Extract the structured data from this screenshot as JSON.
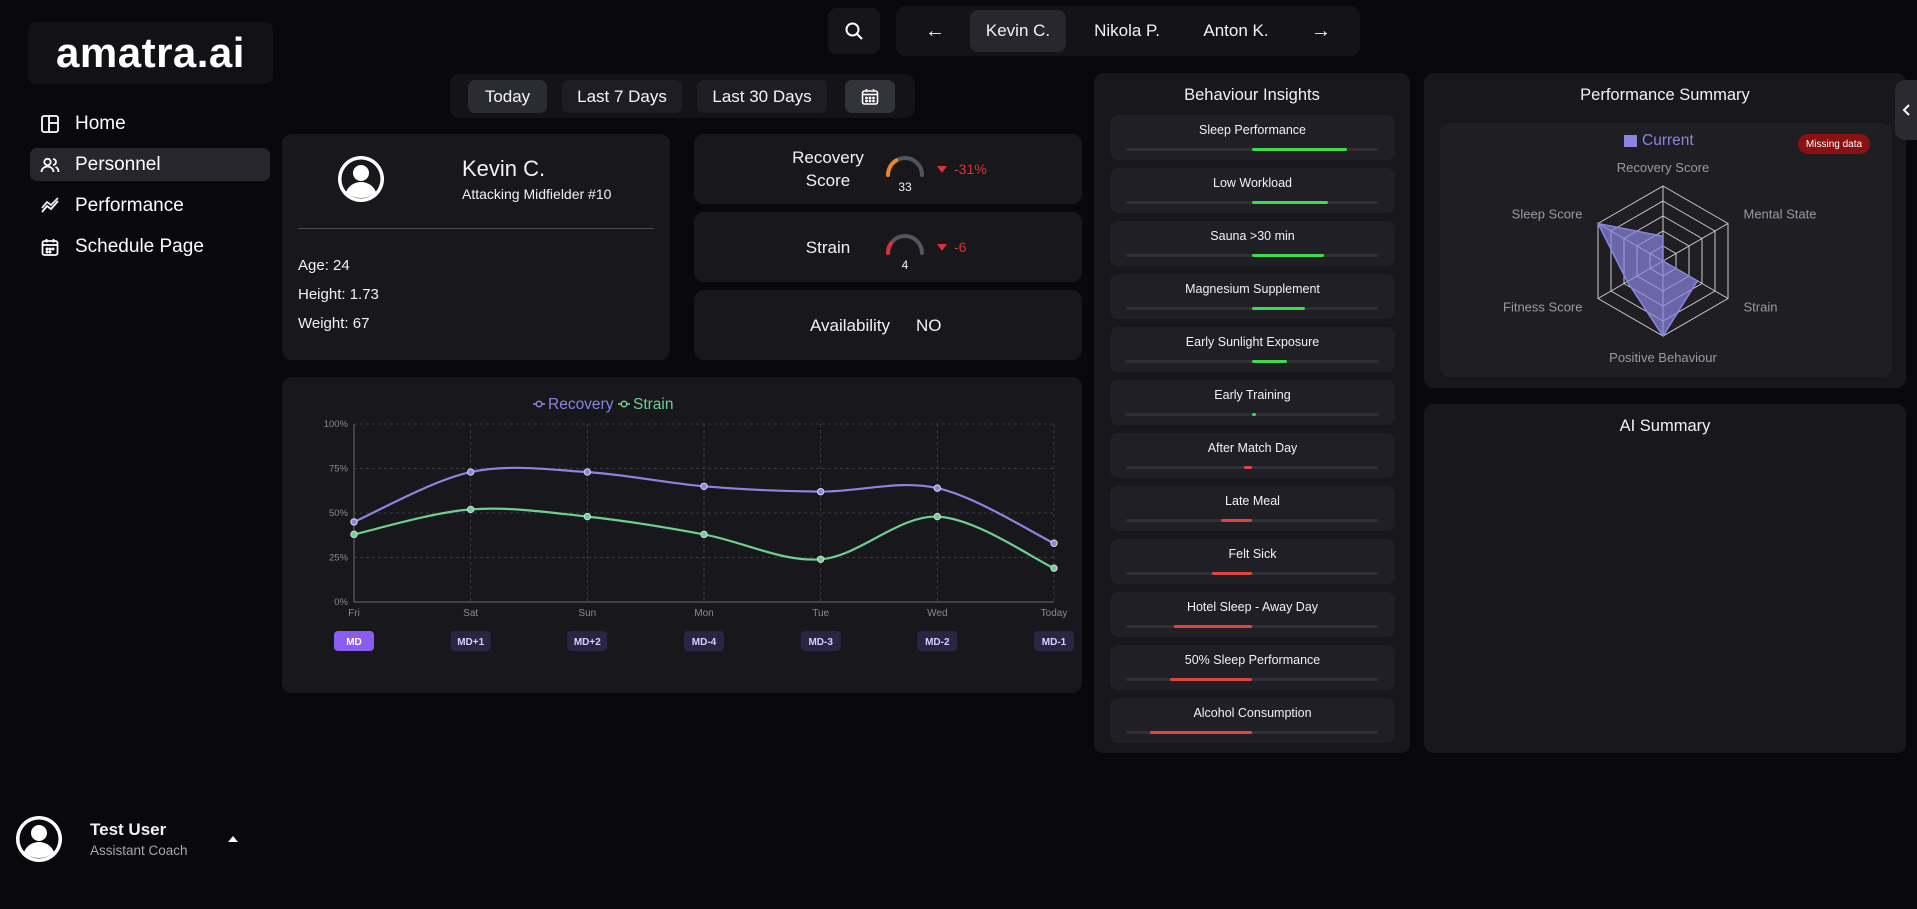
{
  "brand": {
    "logo": "amatra.ai"
  },
  "nav": {
    "items": [
      {
        "label": "Home",
        "icon": "layout-icon",
        "active": false
      },
      {
        "label": "Personnel",
        "icon": "users-icon",
        "active": true
      },
      {
        "label": "Performance",
        "icon": "trend-icon",
        "active": false
      },
      {
        "label": "Schedule Page",
        "icon": "calendar-icon",
        "active": false
      }
    ]
  },
  "user": {
    "name": "Test User",
    "role": "Assistant Coach"
  },
  "players": {
    "prev": "←",
    "next": "→",
    "tabs": [
      "Kevin C.",
      "Nikola P.",
      "Anton K."
    ],
    "active": "Kevin C."
  },
  "range": {
    "options": [
      "Today",
      "Last 7 Days",
      "Last 30 Days"
    ],
    "active": "Today"
  },
  "profile": {
    "name": "Kevin C.",
    "position": "Attacking Midfielder #10",
    "age": "Age: 24",
    "height": "Height: 1.73",
    "weight": "Weight: 67"
  },
  "metrics": {
    "recovery": {
      "label_line1": "Recovery",
      "label_line2": "Score",
      "value": "33",
      "delta": "-31%",
      "gauge_color": "#e8862b",
      "gauge_fraction": 0.33
    },
    "strain": {
      "label": "Strain",
      "value": "4",
      "delta": "-6",
      "gauge_color": "#d8333a",
      "gauge_fraction": 0.19
    },
    "availability": {
      "label": "Availability",
      "value": "NO"
    }
  },
  "chart_data": {
    "type": "line",
    "legend": [
      "Recovery",
      "Strain"
    ],
    "x": [
      "Fri",
      "Sat",
      "Sun",
      "Mon",
      "Tue",
      "Wed",
      "Today"
    ],
    "ytick_labels": [
      "0%",
      "25%",
      "50%",
      "75%",
      "100%"
    ],
    "ylim": [
      0,
      100
    ],
    "series": [
      {
        "name": "Recovery",
        "color": "#8b85e0",
        "values": [
          45,
          73,
          73,
          65,
          62,
          64,
          33
        ]
      },
      {
        "name": "Strain",
        "color": "#6fcf8e",
        "values": [
          38,
          52,
          48,
          38,
          24,
          48,
          19
        ]
      }
    ],
    "match_days": [
      "MD",
      "MD+1",
      "MD+2",
      "MD-4",
      "MD-3",
      "MD-2",
      "MD-1"
    ],
    "active_match_day": "MD",
    "grid": true
  },
  "behaviour": {
    "title": "Behaviour Insights",
    "items": [
      {
        "label": "Sleep Performance",
        "side": "positive",
        "fraction": 0.75
      },
      {
        "label": "Low Workload",
        "side": "positive",
        "fraction": 0.6
      },
      {
        "label": "Sauna >30 min",
        "side": "positive",
        "fraction": 0.57
      },
      {
        "label": "Magnesium Supplement",
        "side": "positive",
        "fraction": 0.42
      },
      {
        "label": "Early Sunlight Exposure",
        "side": "positive",
        "fraction": 0.28
      },
      {
        "label": "Early Training",
        "side": "positive",
        "fraction": 0.03
      },
      {
        "label": "After Match Day",
        "side": "negative",
        "fraction": 0.06
      },
      {
        "label": "Late Meal",
        "side": "negative",
        "fraction": 0.25
      },
      {
        "label": "Felt Sick",
        "side": "negative",
        "fraction": 0.32
      },
      {
        "label": "Hotel Sleep - Away Day",
        "side": "negative",
        "fraction": 0.62
      },
      {
        "label": "50% Sleep Performance",
        "side": "negative",
        "fraction": 0.65
      },
      {
        "label": "Alcohol Consumption",
        "side": "negative",
        "fraction": 0.81
      }
    ],
    "positive_color": "#3ddc4a",
    "negative_color": "#e0443e"
  },
  "performance": {
    "title": "Performance Summary",
    "legend": "Current",
    "badge": "Missing data",
    "axes": [
      "Recovery Score",
      "Mental State",
      "Strain",
      "Positive Behaviour",
      "Fitness Score",
      "Sleep Score"
    ],
    "values": [
      0.33,
      0.0,
      0.53,
      1.0,
      0.55,
      1.0
    ],
    "fill_color": "#8b85e0"
  },
  "ai": {
    "title": "AI Summary"
  }
}
